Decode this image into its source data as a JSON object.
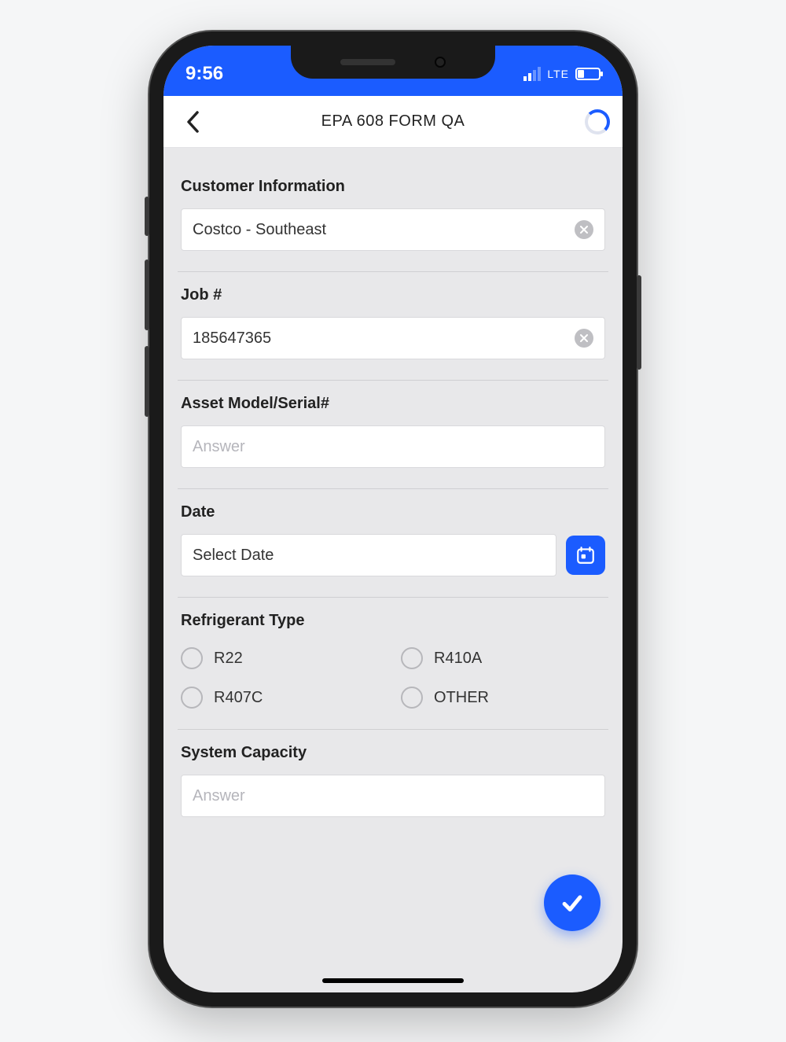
{
  "statusbar": {
    "time": "9:56",
    "network": "LTE"
  },
  "header": {
    "title": "EPA 608 FORM QA"
  },
  "form": {
    "customer": {
      "label": "Customer Information",
      "value": "Costco - Southeast"
    },
    "job": {
      "label": "Job #",
      "value": "185647365"
    },
    "asset": {
      "label": "Asset Model/Serial#",
      "placeholder": "Answer",
      "value": ""
    },
    "date": {
      "label": "Date",
      "value": "Select Date"
    },
    "refrigerant": {
      "label": "Refrigerant Type",
      "options": [
        "R22",
        "R410A",
        "R407C",
        "OTHER"
      ]
    },
    "capacity": {
      "label": "System Capacity",
      "placeholder": "Answer",
      "value": ""
    }
  }
}
